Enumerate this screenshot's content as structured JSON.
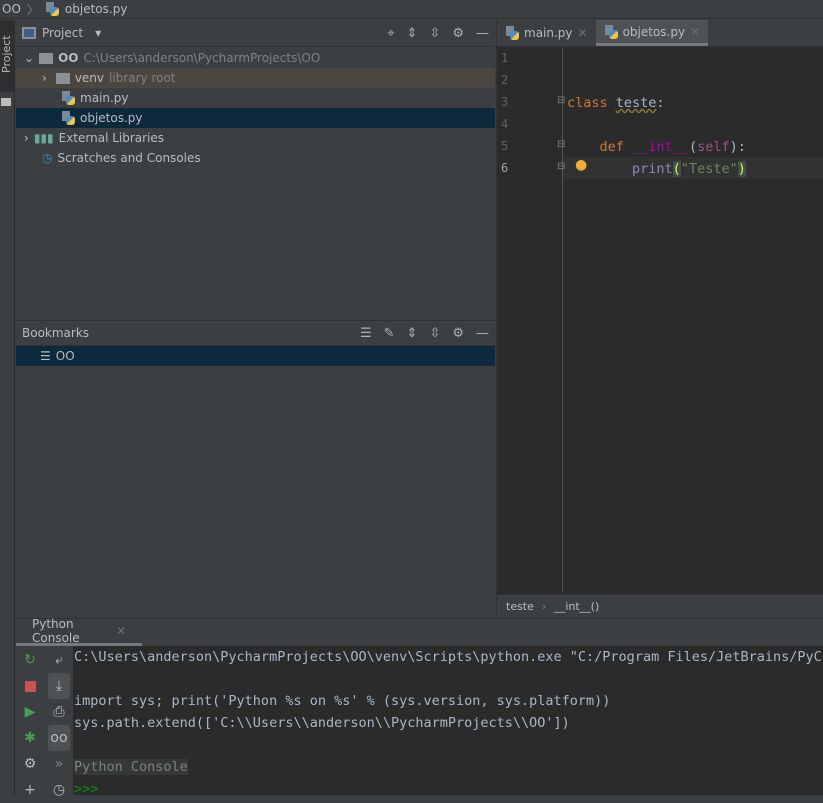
{
  "breadcrumb": {
    "project": "OO",
    "file": "objetos.py"
  },
  "left_stripe": {
    "project_tab": "Project"
  },
  "project_panel": {
    "title": "Project",
    "tree": [
      {
        "label": "OO",
        "hint": "C:\\Users\\anderson\\PycharmProjects\\OO",
        "icon": "folder-icon",
        "expanded": true
      },
      {
        "label": "venv",
        "hint": "library root",
        "icon": "folder-icon",
        "expanded": false
      },
      {
        "label": "main.py",
        "icon": "python-file-icon"
      },
      {
        "label": "objetos.py",
        "icon": "python-file-icon",
        "selected": true
      },
      {
        "label": "External Libraries",
        "icon": "libraries-icon",
        "expanded": false
      },
      {
        "label": "Scratches and Consoles",
        "icon": "scratches-icon"
      }
    ]
  },
  "bookmarks": {
    "title": "Bookmarks",
    "items": [
      {
        "label": "OO"
      }
    ]
  },
  "editor": {
    "tabs": [
      {
        "label": "main.py"
      },
      {
        "label": "objetos.py",
        "active": true
      }
    ],
    "line_numbers": [
      "1",
      "2",
      "3",
      "4",
      "5",
      "6"
    ],
    "code": {
      "l3_kw": "class",
      "l3_name": "teste",
      "l3_end": ":",
      "l5_kw": "def",
      "l5_fn": "__int__",
      "l5_open": "(",
      "l5_self": "self",
      "l5_end": "):",
      "l6_print": "print",
      "l6_open": "(",
      "l6_str": "\"Teste\"",
      "l6_close": ")"
    },
    "breadcrumb": [
      "teste",
      "__int__()"
    ]
  },
  "console": {
    "tab": "Python Console",
    "lines": [
      "C:\\Users\\anderson\\PycharmProjects\\OO\\venv\\Scripts\\python.exe \"C:/Program Files/JetBrains/PyCharm",
      "",
      "import sys; print('Python %s on %s' % (sys.version, sys.platform))",
      "sys.path.extend(['C:\\\\Users\\\\anderson\\\\PycharmProjects\\\\OO'])",
      "",
      "Python Console"
    ],
    "prompt": ">>>"
  },
  "colors": {
    "accent_selection": "#0d293e",
    "run_green": "#499c54",
    "stop_red": "#c75450",
    "prompt_green": "#0c8f0c"
  }
}
